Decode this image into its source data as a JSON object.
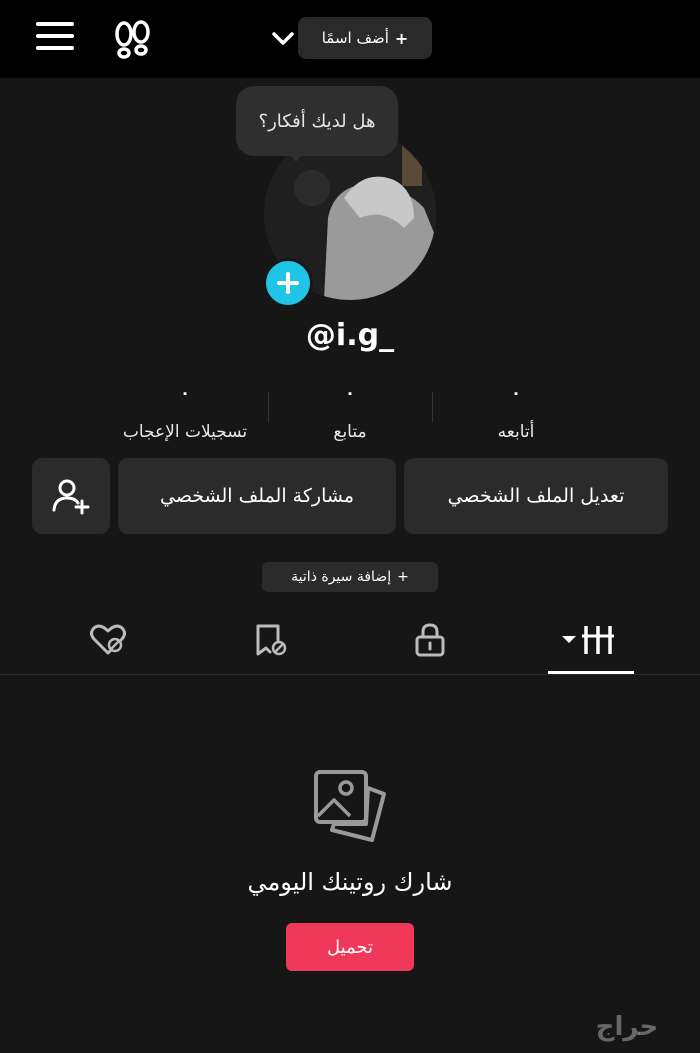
{
  "header": {
    "add_name_label": "أضف اسمًا",
    "add_name_prefix": "+"
  },
  "profile": {
    "thought_bubble": "هل لديك أفكار؟",
    "username": "@i.g_"
  },
  "stats": {
    "likes": {
      "value": "٠",
      "label": "تسجيلات الإعجاب"
    },
    "followers": {
      "value": "٠",
      "label": "متابع"
    },
    "following": {
      "value": "٠",
      "label": "أتابعه"
    }
  },
  "actions": {
    "edit_profile": "تعديل الملف الشخصي",
    "share_profile": "مشاركة الملف الشخصي",
    "add_bio": "إضافة سيرة ذاتية",
    "add_bio_prefix": "+"
  },
  "tabs": {
    "icons": [
      "grid-icon",
      "lock-icon",
      "tagged-video-icon",
      "liked-icon"
    ],
    "active": "grid-icon"
  },
  "empty_state": {
    "message": "شارك روتينك اليومي",
    "upload_label": "تحميل"
  },
  "watermark": "حراج",
  "colors": {
    "background": "#161616",
    "topbar": "#000000",
    "accent_cyan": "#20c4e6",
    "upload_red": "#f0395a",
    "button_gray": "#2b2b2b"
  }
}
